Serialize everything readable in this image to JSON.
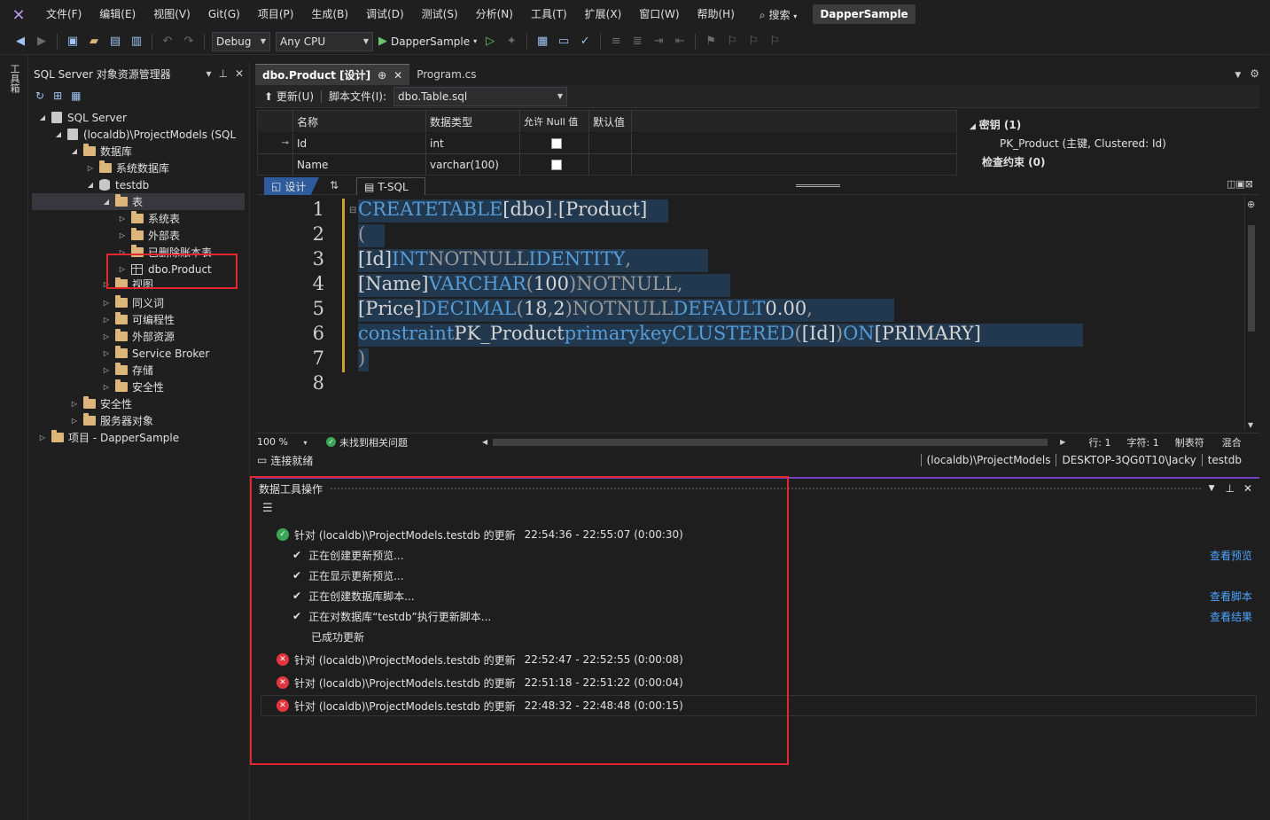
{
  "menu": [
    "文件(F)",
    "编辑(E)",
    "视图(V)",
    "Git(G)",
    "项目(P)",
    "生成(B)",
    "调试(D)",
    "测试(S)",
    "分析(N)",
    "工具(T)",
    "扩展(X)",
    "窗口(W)",
    "帮助(H)"
  ],
  "search_label": "搜索",
  "solution_name": "DapperSample",
  "toolbar": {
    "config": "Debug",
    "platform": "Any CPU",
    "run_target": "DapperSample"
  },
  "vtab_label": "工具箱",
  "explorer": {
    "title": "SQL Server 对象资源管理器",
    "nodes": [
      {
        "label": "SQL Server"
      },
      {
        "label": "(localdb)\\ProjectModels (SQL"
      },
      {
        "label": "数据库"
      },
      {
        "label": "系统数据库"
      },
      {
        "label": "testdb"
      },
      {
        "label": "表"
      },
      {
        "label": "系统表"
      },
      {
        "label": "外部表"
      },
      {
        "label": "已删除账本表"
      },
      {
        "label": "dbo.Product"
      },
      {
        "label": "视图"
      },
      {
        "label": "同义词"
      },
      {
        "label": "可编程性"
      },
      {
        "label": "外部资源"
      },
      {
        "label": "Service Broker"
      },
      {
        "label": "存储"
      },
      {
        "label": "安全性"
      },
      {
        "label": "安全性"
      },
      {
        "label": "服务器对象"
      },
      {
        "label": "项目 - DapperSample"
      }
    ]
  },
  "tabs": [
    {
      "label": "dbo.Product [设计]",
      "pin": "⊕",
      "close": "✕"
    },
    {
      "label": "Program.cs"
    }
  ],
  "designer": {
    "update_label": "更新(U)",
    "script_label": "脚本文件(I):",
    "script_file": "dbo.Table.sql"
  },
  "grid": {
    "headers": [
      "名称",
      "数据类型",
      "允许 Null 值",
      "默认值"
    ],
    "rows": [
      {
        "name": "Id",
        "type": "int",
        "nullable": false,
        "default": ""
      },
      {
        "name": "Name",
        "type": "varchar(100)",
        "nullable": false,
        "default": ""
      }
    ]
  },
  "props": {
    "keys_label": "密钥 (1)",
    "key_item": "PK_Product   (主键, Clustered: Id)",
    "check_label": "检查约束 (0)"
  },
  "split_tabs": {
    "design": "设计",
    "tsql": "T-SQL"
  },
  "code": {
    "line_numbers": [
      "1",
      "2",
      "3",
      "4",
      "5",
      "6",
      "7",
      "8"
    ]
  },
  "code_status": {
    "zoom": "100 %",
    "issues": "未找到相关问题",
    "line": "行: 1",
    "col": "字符: 1",
    "tabs": "制表符",
    "mixed": "混合"
  },
  "conn": {
    "status": "连接就绪",
    "server": "(localdb)\\ProjectModels",
    "user": "DESKTOP-3QG0T10\\Jacky",
    "db": "testdb"
  },
  "dtp": {
    "title": "数据工具操作",
    "ops": [
      {
        "status": "ok",
        "text": "针对 (localdb)\\ProjectModels.testdb 的更新",
        "time": "22:54:36 - 22:55:07 (0:00:30)"
      },
      {
        "status": "err",
        "text": "针对 (localdb)\\ProjectModels.testdb 的更新",
        "time": "22:52:47 - 22:52:55 (0:00:08)"
      },
      {
        "status": "err",
        "text": "针对 (localdb)\\ProjectModels.testdb 的更新",
        "time": "22:51:18 - 22:51:22 (0:00:04)"
      },
      {
        "status": "err",
        "text": "针对 (localdb)\\ProjectModels.testdb 的更新",
        "time": "22:48:32 - 22:48:48 (0:00:15)"
      }
    ],
    "steps": [
      "正在创建更新预览...",
      "正在显示更新预览...",
      "正在创建数据库脚本...",
      "正在对数据库“testdb”执行更新脚本...",
      "已成功更新"
    ],
    "links": [
      "查看预览",
      "查看脚本",
      "查看结果"
    ]
  }
}
